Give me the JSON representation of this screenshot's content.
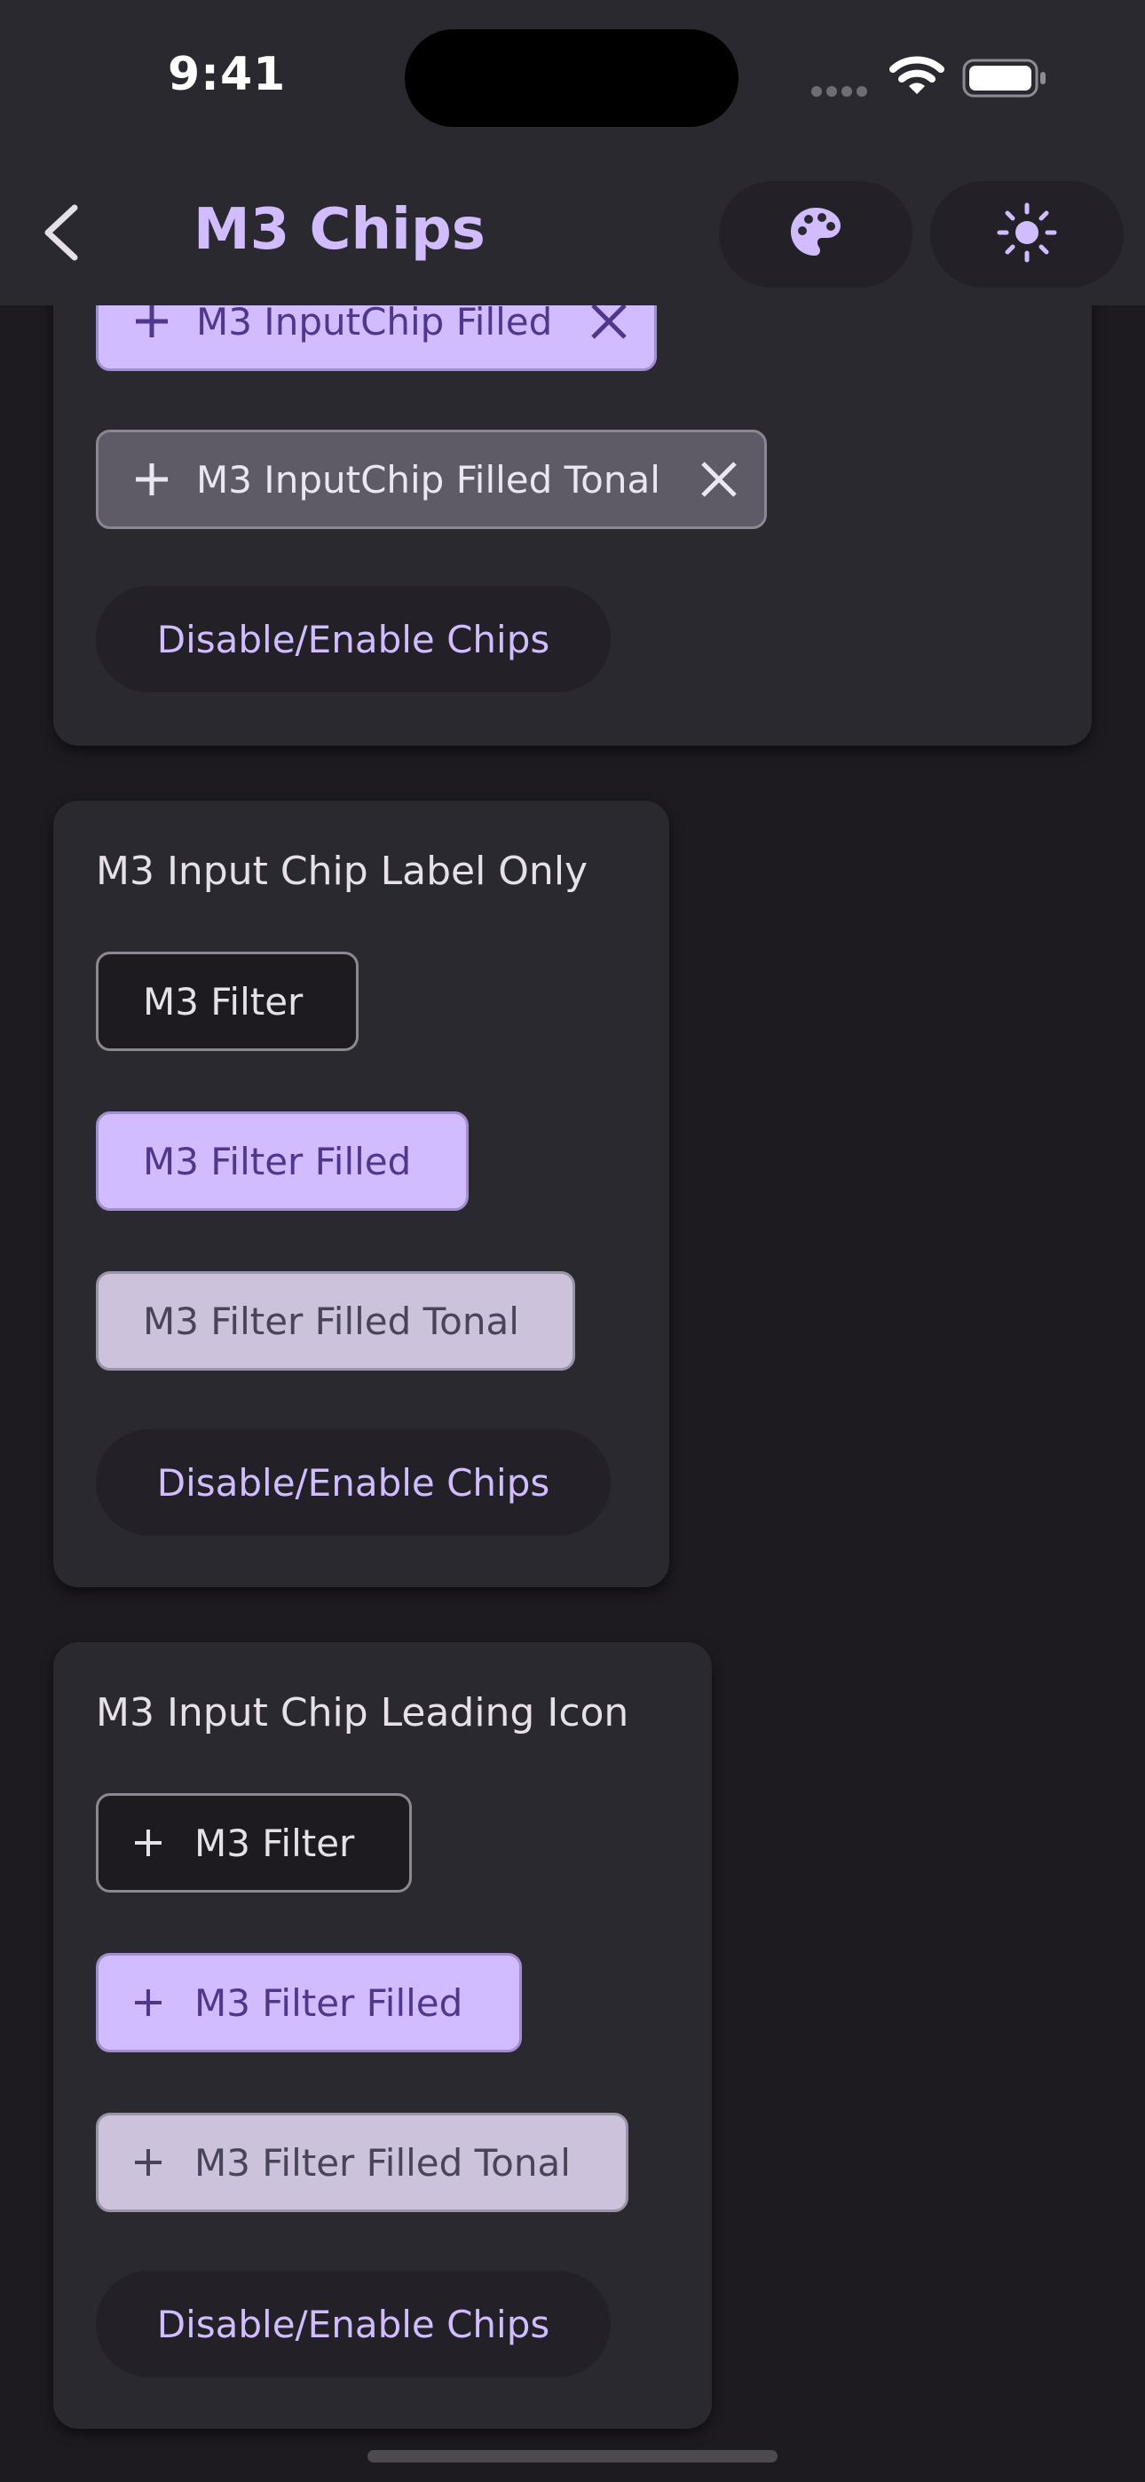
{
  "status_bar": {
    "time": "9:41"
  },
  "app_bar": {
    "title": "M3 Chips",
    "back_icon": "chevron-left-icon",
    "palette_icon": "palette-icon",
    "theme_icon": "sun-icon"
  },
  "colors": {
    "primary": "#d0bcff",
    "background": "#1d1b20",
    "surface": "#2b2930"
  },
  "card_input_chips": {
    "chip_filled": {
      "label": "M3 InputChip Filled",
      "lead_icon": "plus-icon",
      "trail_icon": "close-icon"
    },
    "chip_filled_tonal": {
      "label": "M3 InputChip Filled Tonal",
      "lead_icon": "plus-icon",
      "trail_icon": "close-icon"
    },
    "toggle_button": "Disable/Enable Chips"
  },
  "card_label_only": {
    "title": "M3 Input Chip Label Only",
    "chips": [
      "M3 Filter",
      "M3 Filter Filled",
      "M3 Filter Filled Tonal"
    ],
    "toggle_button": "Disable/Enable Chips"
  },
  "card_leading_icon": {
    "title": "M3 Input Chip Leading Icon",
    "chips": [
      "M3 Filter",
      "M3 Filter Filled",
      "M3 Filter Filled Tonal"
    ],
    "lead_icon": "plus-icon",
    "toggle_button": "Disable/Enable Chips"
  }
}
